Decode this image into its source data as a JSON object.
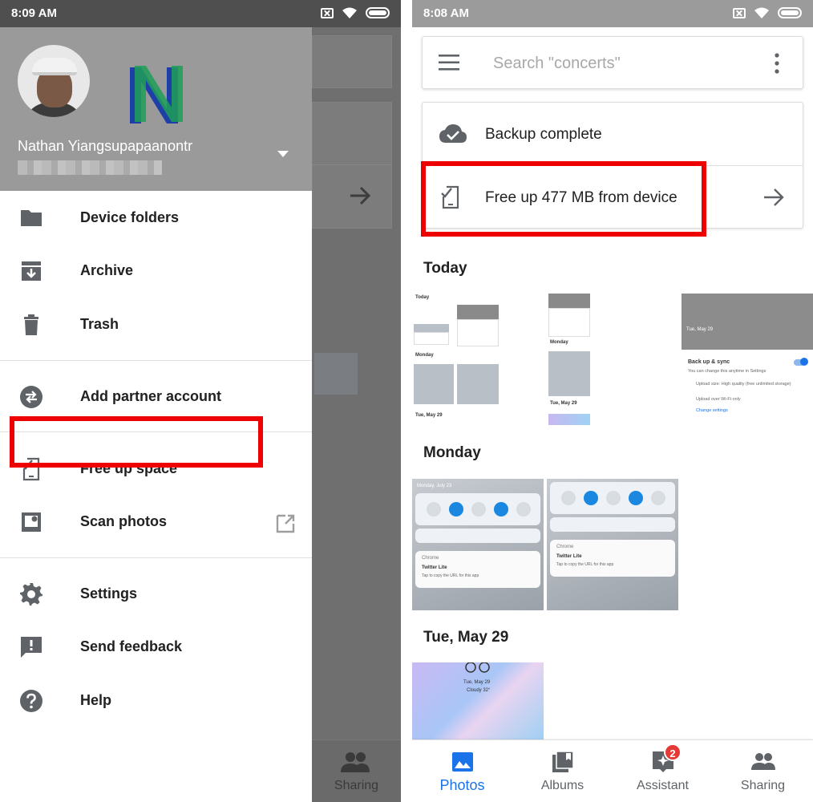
{
  "left_screen": {
    "status_bar": {
      "time": "8:09 AM"
    },
    "drawer": {
      "user_name": "Nathan Yiangsupapaanontr",
      "items": [
        {
          "label": "Device folders",
          "icon": "folder-icon"
        },
        {
          "label": "Archive",
          "icon": "archive-icon"
        },
        {
          "label": "Trash",
          "icon": "trash-icon"
        },
        {
          "label": "Add partner account",
          "icon": "partner-swap-icon"
        },
        {
          "label": "Free up space",
          "icon": "free-up-space-icon"
        },
        {
          "label": "Scan photos",
          "icon": "scan-photos-icon",
          "trailing_icon": "external-link-icon"
        },
        {
          "label": "Settings",
          "icon": "gear-icon"
        },
        {
          "label": "Send feedback",
          "icon": "feedback-icon"
        },
        {
          "label": "Help",
          "icon": "help-icon"
        }
      ]
    },
    "background_nav": {
      "sharing_label": "Sharing"
    }
  },
  "right_screen": {
    "status_bar": {
      "time": "8:08 AM"
    },
    "search": {
      "placeholder": "Search \"concerts\""
    },
    "status_card": {
      "backup_label": "Backup complete",
      "free_up_label": "Free up 477 MB from device"
    },
    "sections": [
      {
        "title": "Today"
      },
      {
        "title": "Monday"
      },
      {
        "title": "Tue, May 29"
      }
    ],
    "thumbnails": {
      "today_1": {
        "heading": "Today",
        "sub1": "Monday",
        "sub2": "Tue, May 29"
      },
      "today_2": {
        "sub1": "Monday",
        "sub2": "Tue, May 29"
      },
      "today_3": {
        "date": "Tue, May 29",
        "title": "Back up & sync",
        "subtitle": "You can change this anytime in Settings",
        "line1": "Upload size: High quality (free unlimited storage)",
        "line2": "Upload over Wi-Fi only",
        "link": "Change settings"
      },
      "notif": {
        "app": "Chrome",
        "title": "Twitter Lite",
        "body": "Tap to copy the URL for this app",
        "date": "Monday, July 23"
      },
      "lock": {
        "date": "Tue, May 29",
        "weather": "Cloudy 32°"
      }
    },
    "bottom_nav": {
      "items": [
        {
          "label": "Photos",
          "icon": "photos-icon",
          "active": true
        },
        {
          "label": "Albums",
          "icon": "albums-icon"
        },
        {
          "label": "Assistant",
          "icon": "assistant-icon",
          "badge": "2"
        },
        {
          "label": "Sharing",
          "icon": "sharing-icon"
        }
      ]
    }
  },
  "colors": {
    "highlight": "#ee0000",
    "accent": "#1a73e8",
    "badge": "#e53935"
  }
}
